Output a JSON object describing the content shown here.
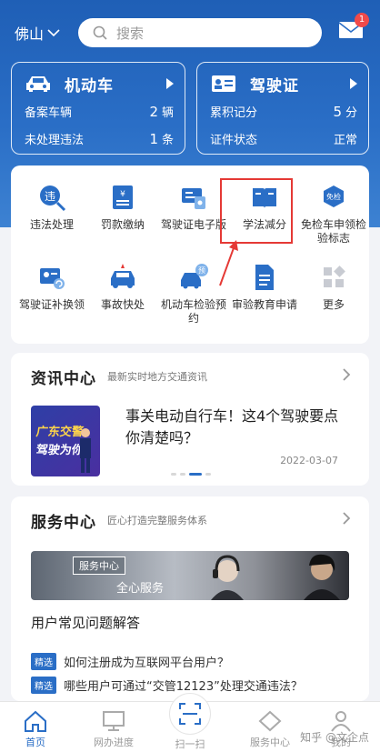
{
  "header": {
    "city": "佛山",
    "search_placeholder": "搜索",
    "mail_badge": "1"
  },
  "cards": {
    "vehicle": {
      "title": "机动车",
      "row1_label": "备案车辆",
      "row1_value": "2",
      "row1_unit": "辆",
      "row2_label": "未处理违法",
      "row2_value": "1",
      "row2_unit": "条"
    },
    "license": {
      "title": "驾驶证",
      "row1_label": "累积记分",
      "row1_value": "5",
      "row1_unit": "分",
      "row2_label": "证件状态",
      "row2_value": "正常"
    }
  },
  "services": [
    {
      "label": "违法处理",
      "icon": "violation-icon"
    },
    {
      "label": "罚款缴纳",
      "icon": "fine-payment-icon"
    },
    {
      "label": "驾驶证电子版",
      "icon": "e-license-icon"
    },
    {
      "label": "学法减分",
      "icon": "study-book-icon"
    },
    {
      "label": "免检车申领检验标志",
      "icon": "inspection-exempt-icon"
    },
    {
      "label": "驾驶证补换领",
      "icon": "license-replace-icon"
    },
    {
      "label": "事故快处",
      "icon": "accident-icon"
    },
    {
      "label": "机动车检验预约",
      "icon": "inspection-booking-icon"
    },
    {
      "label": "审验教育申请",
      "icon": "education-doc-icon"
    },
    {
      "label": "更多",
      "icon": "more-grid-icon"
    }
  ],
  "news": {
    "title": "资讯中心",
    "subtitle": "最新实时地方交通资讯",
    "thumb_line1": "广东交警",
    "thumb_line2": "驾驶为你",
    "headline": "事关电动自行车！这4个驾驶要点你清楚吗？",
    "date": "2022-03-07"
  },
  "service_center": {
    "title": "服务中心",
    "subtitle": "匠心打造完整服务体系",
    "banner_tag": "服务中心",
    "banner_text": "全心服务",
    "faq_title": "用户常见问题解答",
    "faq": [
      {
        "tag": "精选",
        "text": "如何注册成为互联网平台用户？"
      },
      {
        "tag": "精选",
        "text": "哪些用户可通过“交管12123”处理交通违法？"
      }
    ]
  },
  "tabbar": {
    "home": "首页",
    "progress": "网办进度",
    "scan": "扫一扫",
    "service": "服务中心",
    "mine": "我的"
  },
  "watermark": "知乎 @文企点",
  "colors": {
    "primary": "#2a6ec6",
    "highlight": "#e53935",
    "badge": "#f04a4a"
  }
}
